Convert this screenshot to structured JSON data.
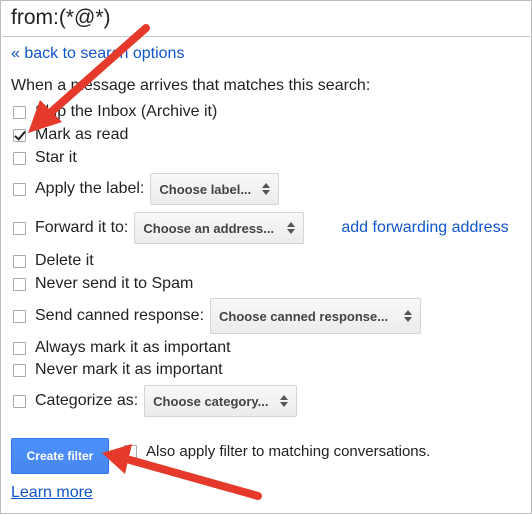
{
  "search": {
    "query": "from:(*@*)"
  },
  "nav": {
    "back_link": "« back to search options"
  },
  "intro": "When a message arrives that matches this search:",
  "options": {
    "skip_inbox": "Skip the Inbox (Archive it)",
    "mark_as_read": "Mark as read",
    "star_it": "Star it",
    "apply_label": "Apply the label:",
    "apply_label_dropdown": "Choose label...",
    "forward_to": "Forward it to:",
    "forward_dropdown": "Choose an address...",
    "add_forwarding": "add forwarding address",
    "delete_it": "Delete it",
    "never_spam": "Never send it to Spam",
    "canned_response": "Send canned response:",
    "canned_dropdown": "Choose canned response...",
    "always_important": "Always mark it as important",
    "never_important": "Never mark it as important",
    "categorize_as": "Categorize as:",
    "categorize_dropdown": "Choose category..."
  },
  "actions": {
    "create_filter": "Create filter",
    "also_apply": "Also apply filter to matching conversations.",
    "learn_more": "Learn more"
  },
  "colors": {
    "link": "#1155cc",
    "button": "#4d90fe",
    "annotation_arrow": "#e53a2b"
  },
  "checked_option": "mark_as_read"
}
